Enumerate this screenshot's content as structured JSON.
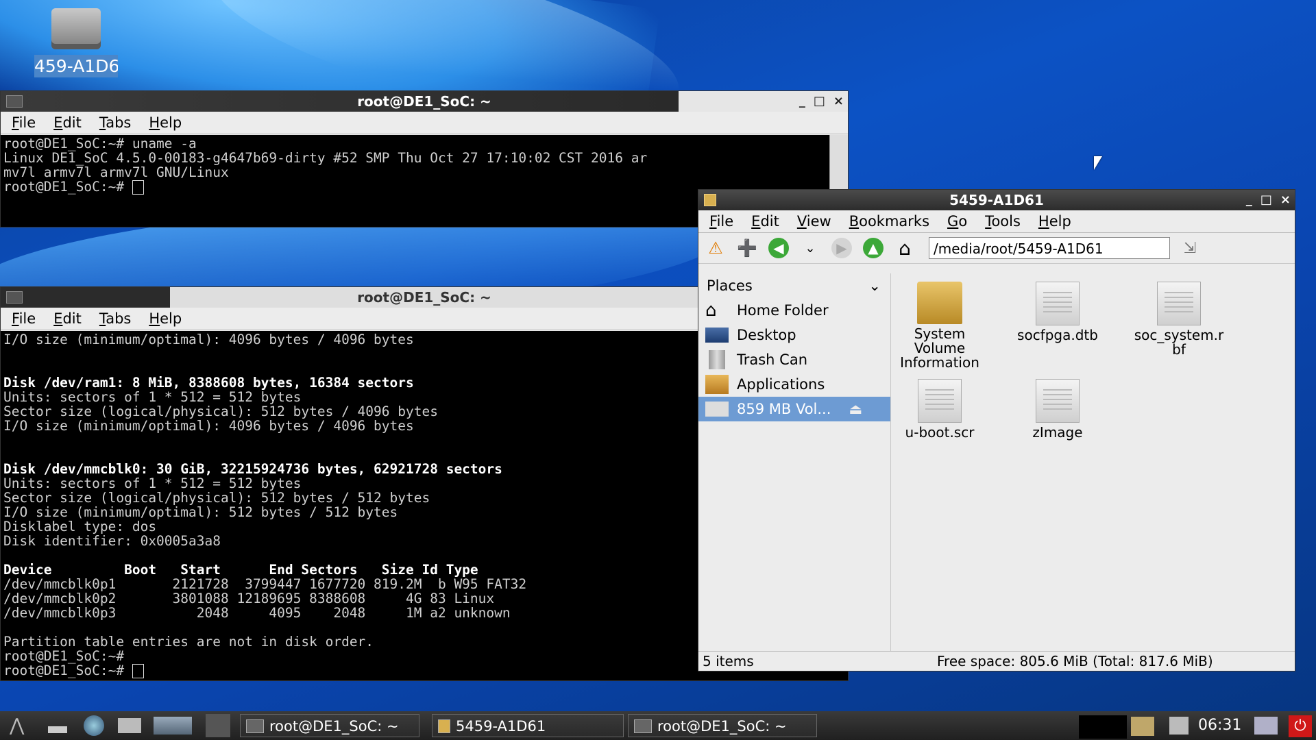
{
  "desktop": {
    "icon_label": "459-A1D6"
  },
  "menus": {
    "file": "File",
    "edit": "Edit",
    "tabs": "Tabs",
    "help": "Help",
    "view": "View",
    "bookmarks": "Bookmarks",
    "go": "Go",
    "tools": "Tools"
  },
  "terminal1": {
    "title": "root@DE1_SoC: ~",
    "lines": [
      "root@DE1_SoC:~# uname -a",
      "Linux DE1_SoC 4.5.0-00183-g4647b69-dirty #52 SMP Thu Oct 27 17:10:02 CST 2016 ar",
      "mv7l armv7l armv7l GNU/Linux",
      "root@DE1_SoC:~# "
    ]
  },
  "terminal2": {
    "title": "root@DE1_SoC: ~",
    "lines": [
      "I/O size (minimum/optimal): 4096 bytes / 4096 bytes",
      "",
      "",
      "Disk /dev/ram1: 8 MiB, 8388608 bytes, 16384 sectors",
      "Units: sectors of 1 * 512 = 512 bytes",
      "Sector size (logical/physical): 512 bytes / 4096 bytes",
      "I/O size (minimum/optimal): 4096 bytes / 4096 bytes",
      "",
      "",
      "Disk /dev/mmcblk0: 30 GiB, 32215924736 bytes, 62921728 sectors",
      "Units: sectors of 1 * 512 = 512 bytes",
      "Sector size (logical/physical): 512 bytes / 512 bytes",
      "I/O size (minimum/optimal): 512 bytes / 512 bytes",
      "Disklabel type: dos",
      "Disk identifier: 0x0005a3a8",
      "",
      "Device         Boot   Start      End Sectors   Size Id Type",
      "/dev/mmcblk0p1       2121728  3799447 1677720 819.2M  b W95 FAT32",
      "/dev/mmcblk0p2       3801088 12189695 8388608     4G 83 Linux",
      "/dev/mmcblk0p3          2048     4095    2048     1M a2 unknown",
      "",
      "Partition table entries are not in disk order.",
      "root@DE1_SoC:~#",
      "root@DE1_SoC:~# "
    ],
    "bold_lines": [
      3,
      9,
      16
    ]
  },
  "filemanager": {
    "title": "5459-A1D61",
    "path": "/media/root/5459-A1D61",
    "places_label": "Places",
    "places": [
      "Home Folder",
      "Desktop",
      "Trash Can",
      "Applications",
      "859 MB Vol..."
    ],
    "files": [
      "System Volume Information",
      "socfpga.dtb",
      "soc_system.r bf",
      "u-boot.scr",
      "zImage"
    ],
    "status_items": "5 items",
    "status_free": "Free space: 805.6 MiB (Total: 817.6 MiB)"
  },
  "taskbar": {
    "tasks": [
      "root@DE1_SoC: ~",
      "5459-A1D61",
      "root@DE1_SoC: ~"
    ],
    "clock": "06:31"
  }
}
